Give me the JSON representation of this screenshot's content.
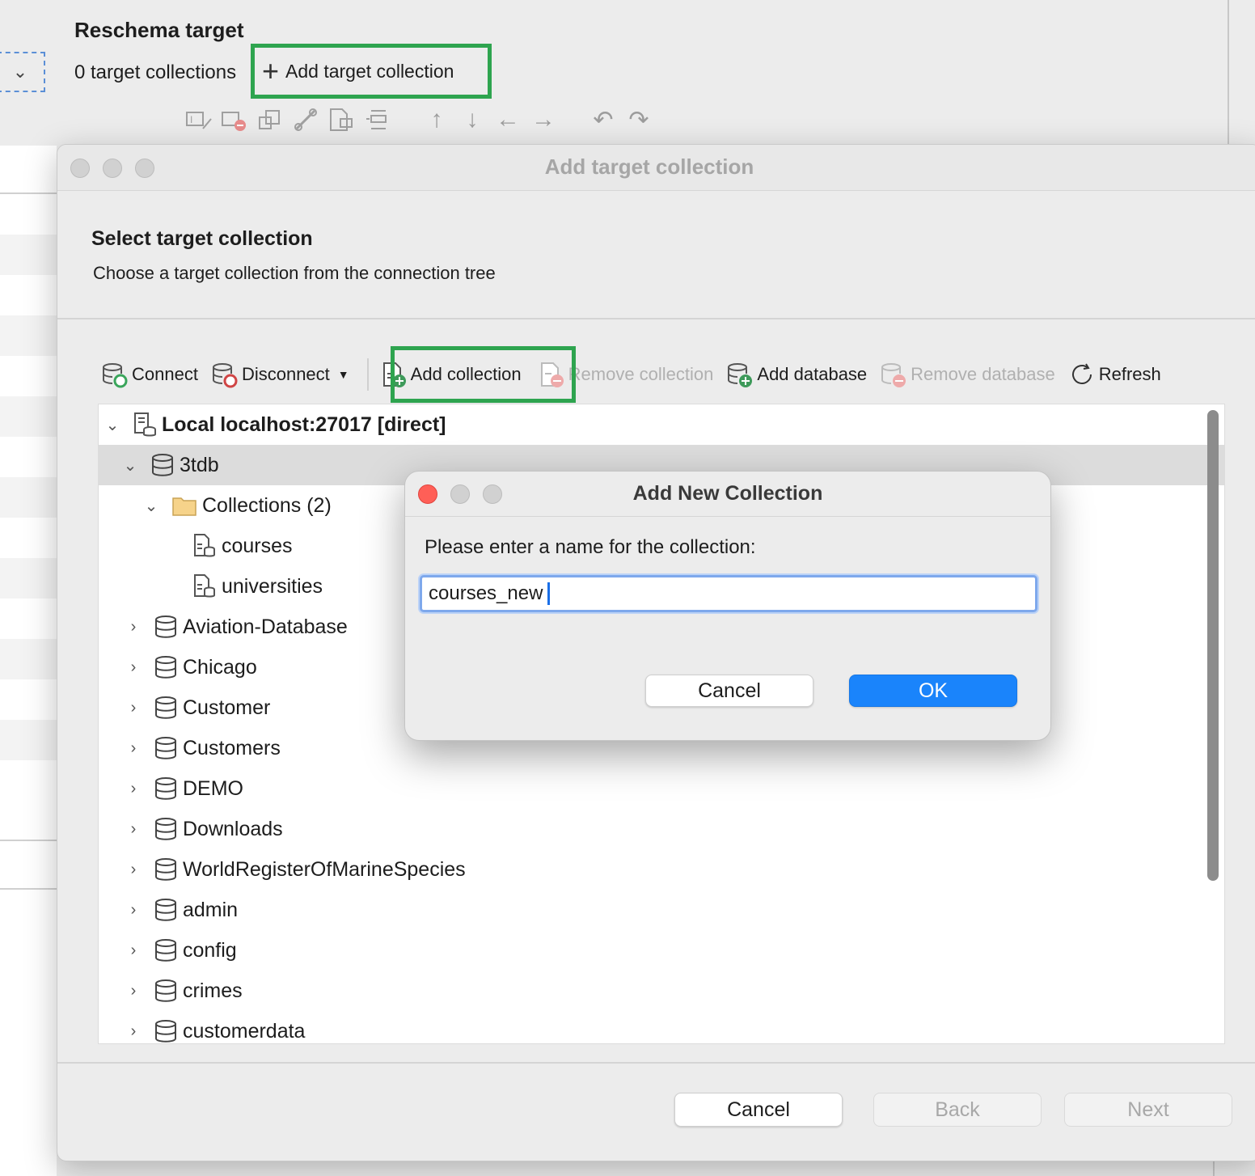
{
  "background": {
    "section_title": "Reschema target",
    "target_count": "0 target collections",
    "add_target_label": "Add target collection",
    "tool_icons": [
      "edit-field-icon",
      "remove-field-icon",
      "resize-icon",
      "link-icon",
      "move-to-icon",
      "align-icon",
      "arrow-up-icon",
      "arrow-down-icon",
      "arrow-left-icon",
      "arrow-right-icon",
      "undo-icon",
      "redo-icon"
    ]
  },
  "wizard": {
    "title": "Add target collection",
    "heading": "Select target collection",
    "subheading": "Choose a target collection from the connection tree",
    "toolbar": {
      "connect": "Connect",
      "disconnect": "Disconnect",
      "add_collection": "Add collection",
      "remove_collection": "Remove collection",
      "add_database": "Add database",
      "remove_database": "Remove database",
      "refresh": "Refresh"
    },
    "tree": {
      "connection": "Local localhost:27017 [direct]",
      "selected_db": "3tdb",
      "folder": "Collections (2)",
      "collections": [
        "courses",
        "universities"
      ],
      "databases": [
        "Aviation-Database",
        "Chicago",
        "Customer",
        "Customers",
        "DEMO",
        "Downloads",
        "WorldRegisterOfMarineSpecies",
        "admin",
        "config",
        "crimes",
        "customerdata"
      ]
    },
    "footer": {
      "cancel": "Cancel",
      "back": "Back",
      "next": "Next"
    }
  },
  "modal": {
    "title": "Add New Collection",
    "prompt": "Please enter a name for the collection:",
    "input_value": "courses_new",
    "cancel": "Cancel",
    "ok": "OK"
  },
  "colors": {
    "highlight": "#2ea44f",
    "primary_button": "#1a84fb",
    "close_button": "#ff5f57"
  }
}
